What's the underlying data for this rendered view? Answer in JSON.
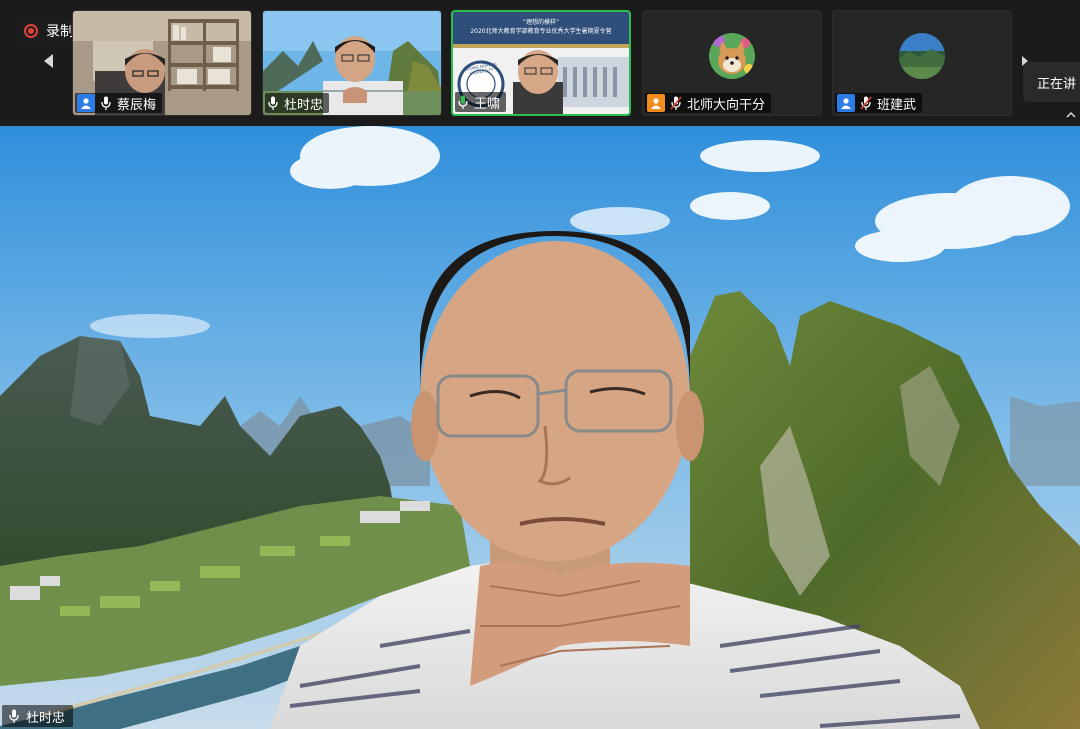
{
  "recording": {
    "label": "录制中"
  },
  "participants": [
    {
      "name": "蔡辰梅",
      "active": false,
      "badge_color": "#2d7be5"
    },
    {
      "name": "杜时忠",
      "active": false,
      "badge_color": ""
    },
    {
      "name": "王啸",
      "active": true,
      "badge_color": ""
    },
    {
      "name": "北师大向干分",
      "active": false,
      "badge_color": "#f08c1c"
    },
    {
      "name": "班建武",
      "active": false,
      "badge_color": "#2d7be5"
    }
  ],
  "slide": {
    "title_line1": "“理想的模样”",
    "title_line2": "2020北师大教育学部教育专业优秀大学生暑期夏令营",
    "seal_text": "BEIJING NORMAL UNIVERSITY"
  },
  "speaking": {
    "label": "正在讲"
  },
  "main_speaker": {
    "name": "杜时忠"
  },
  "colors": {
    "active_border": "#2dbd4f",
    "recording_red": "#e0403a",
    "user_blue": "#2d7be5",
    "user_orange": "#f08c1c"
  },
  "icons": [
    "record-icon",
    "chevron-left-icon",
    "chevron-right-icon",
    "chevron-up-icon",
    "user-icon",
    "microphone-icon",
    "microphone-muted-icon"
  ]
}
